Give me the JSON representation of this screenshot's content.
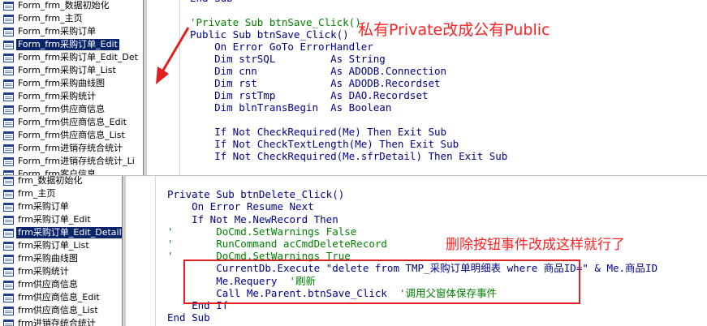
{
  "top_panel": {
    "tree_items": [
      {
        "label": "Form_frm_数据初始化",
        "selected": false
      },
      {
        "label": "Form_frm_主页",
        "selected": false
      },
      {
        "label": "Form_frm采购订单",
        "selected": false
      },
      {
        "label": "Form_frm采购订单_Edit",
        "selected": true
      },
      {
        "label": "Form_frm采购订单_Edit_Det",
        "selected": false
      },
      {
        "label": "Form_frm采购订单_List",
        "selected": false
      },
      {
        "label": "Form_frm采购曲线图",
        "selected": false
      },
      {
        "label": "Form_frm采购统计",
        "selected": false
      },
      {
        "label": "Form_frm供应商信息",
        "selected": false
      },
      {
        "label": "Form_frm供应商信息_Edit",
        "selected": false
      },
      {
        "label": "Form_frm供应商信息_List",
        "selected": false
      },
      {
        "label": "Form_frm进销存统合统计",
        "selected": false
      },
      {
        "label": "Form_frm进销存统合统计_Li",
        "selected": false
      },
      {
        "label": "Form_frm客户信息",
        "selected": false
      }
    ],
    "code_lines": [
      [
        [
          "End Sub",
          "kw"
        ]
      ],
      [
        [
          "",
          "tx"
        ]
      ],
      [
        [
          "'Private Sub btnSave_Click()",
          "cm"
        ]
      ],
      [
        [
          "Public Sub btnSave_Click()",
          "tx"
        ]
      ],
      [
        [
          "    On Error GoTo ErrorHandler",
          "tx"
        ]
      ],
      [
        [
          "    Dim strSQL         As String",
          "tx"
        ]
      ],
      [
        [
          "    Dim cnn            As ADODB.Connection",
          "tx"
        ]
      ],
      [
        [
          "    Dim rst            As ADODB.Recordset",
          "tx"
        ]
      ],
      [
        [
          "    Dim rstTmp         As DAO.Recordset",
          "tx"
        ]
      ],
      [
        [
          "    Dim blnTransBegin  As Boolean",
          "tx"
        ]
      ],
      [
        [
          "",
          "tx"
        ]
      ],
      [
        [
          "    If Not CheckRequired(Me) Then Exit Sub",
          "tx"
        ]
      ],
      [
        [
          "    If Not CheckTextLength(Me) Then Exit Sub",
          "tx"
        ]
      ],
      [
        [
          "    If Not CheckRequired(Me.sfrDetail) Then Exit Sub",
          "tx"
        ]
      ],
      [
        [
          "",
          "tx"
        ]
      ],
      [
        [
          "    ' - - - - - - - - - - - - - - - - - - - -",
          "cm"
        ]
      ]
    ],
    "annotation": "私有Private改成公有Public"
  },
  "bottom_panel": {
    "tree_items": [
      {
        "label": "frm_数据初始化",
        "selected": false
      },
      {
        "label": "frm_主页",
        "selected": false
      },
      {
        "label": "frm采购订单",
        "selected": false
      },
      {
        "label": "frm采购订单_Edit",
        "selected": false
      },
      {
        "label": "frm采购订单_Edit_Detail",
        "selected": true
      },
      {
        "label": "frm采购订单_List",
        "selected": false
      },
      {
        "label": "frm采购曲线图",
        "selected": false
      },
      {
        "label": "frm采购统计",
        "selected": false
      },
      {
        "label": "frm供应商信息",
        "selected": false
      },
      {
        "label": "frm供应商信息_Edit",
        "selected": false
      },
      {
        "label": "frm供应商信息_List",
        "selected": false
      },
      {
        "label": "frm进销存统合统计",
        "selected": false
      }
    ],
    "code_lines": [
      [
        [
          "",
          "tx"
        ]
      ],
      [
        [
          "Private Sub btnDelete_Click()",
          "tx"
        ]
      ],
      [
        [
          "    On Error Resume Next",
          "tx"
        ]
      ],
      [
        [
          "    If Not Me.NewRecord Then",
          "tx"
        ]
      ],
      [
        [
          "'       DoCmd.SetWarnings False",
          "cm"
        ]
      ],
      [
        [
          "'       RunCommand acCmdDeleteRecord",
          "cm"
        ]
      ],
      [
        [
          "'       DoCmd.SetWarnings True",
          "cm"
        ]
      ],
      [
        [
          "        CurrentDb.Execute \"delete from TMP_采购订单明细表 where 商品ID=\" & Me.商品ID",
          "tx"
        ]
      ],
      [
        [
          "        Me.Requery  ",
          "tx"
        ],
        [
          "'刷新",
          "cm"
        ]
      ],
      [
        [
          "        Call Me.Parent.btnSave_Click  ",
          "tx"
        ],
        [
          "'调用父窗体保存事件",
          "cm"
        ]
      ],
      [
        [
          "    End If",
          "tx"
        ]
      ],
      [
        [
          "End Sub",
          "tx"
        ]
      ]
    ],
    "annotation": "删除按钮事件改成这样就行了"
  }
}
